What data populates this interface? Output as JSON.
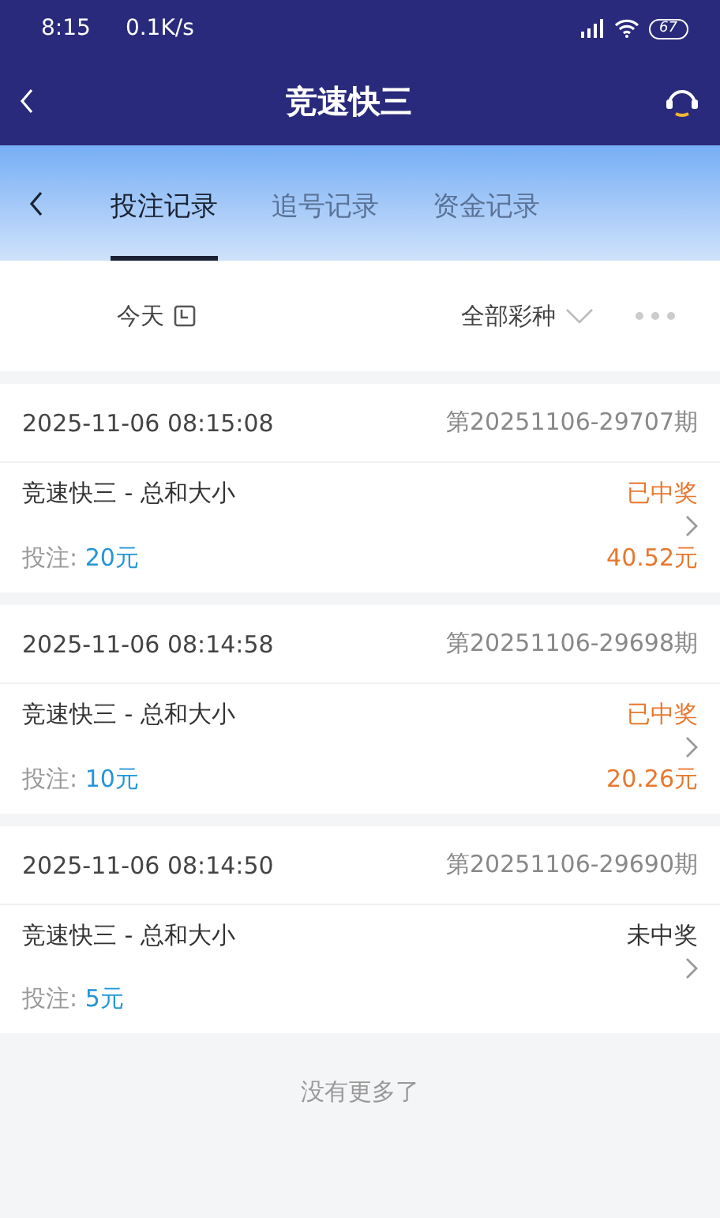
{
  "status_bar": {
    "time": "8:15",
    "speed": "0.1K/s",
    "battery": "67"
  },
  "header": {
    "title": "竞速快三"
  },
  "tabs": [
    {
      "label": "投注记录",
      "selected": true
    },
    {
      "label": "追号记录",
      "selected": false
    },
    {
      "label": "资金记录",
      "selected": false
    }
  ],
  "filter": {
    "date": "今天",
    "lottery": "全部彩种"
  },
  "records": [
    {
      "time": "2025-11-06 08:15:08",
      "issue": "第20251106-29707期",
      "name": "竞速快三 - 总和大小",
      "status": "已中奖",
      "won": true,
      "bet_label": "投注:",
      "bet": "20元",
      "prize": "40.52元"
    },
    {
      "time": "2025-11-06 08:14:58",
      "issue": "第20251106-29698期",
      "name": "竞速快三 - 总和大小",
      "status": "已中奖",
      "won": true,
      "bet_label": "投注:",
      "bet": "10元",
      "prize": "20.26元"
    },
    {
      "time": "2025-11-06 08:14:50",
      "issue": "第20251106-29690期",
      "name": "竞速快三 - 总和大小",
      "status": "未中奖",
      "won": false,
      "bet_label": "投注:",
      "bet": "5元"
    }
  ],
  "footer": "没有更多了"
}
